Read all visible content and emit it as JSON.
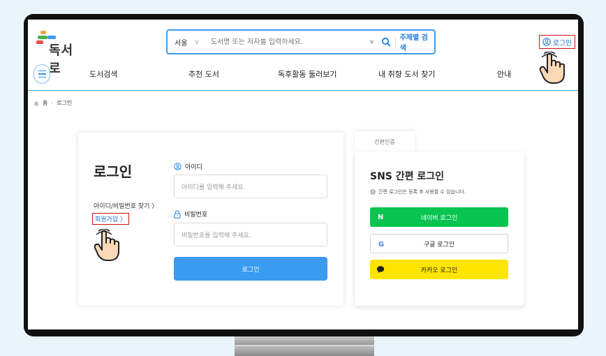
{
  "header": {
    "logo_text": "독서로",
    "search": {
      "region": "서울",
      "placeholder": "도서명 또는 저자를 입력하세요.",
      "topic_search": "주제별 검색"
    },
    "login_link": "로그인"
  },
  "nav": {
    "items": [
      "도서검색",
      "추천 도서",
      "독후활동 둘러보기",
      "내 취향 도서 찾기",
      "안내"
    ]
  },
  "breadcrumb": {
    "home": "홈",
    "current": "로그인"
  },
  "login_panel": {
    "title": "로그인",
    "find_link": "아이디/비밀번호 찾기 〉",
    "join_link": "회원가입 〉",
    "id_label": "아이디",
    "id_placeholder": "아이디를 입력해 주세요.",
    "pw_label": "비밀번호",
    "pw_placeholder": "비밀번호를 입력해 주세요.",
    "login_button": "로그인"
  },
  "sns_panel": {
    "tab": "간편인증",
    "title": "SNS 간편 로그인",
    "note": "간편 로그인은 등록 후 사용할 수 있습니다.",
    "naver": "네이버 로그인",
    "google": "구글 로그인",
    "kakao": "카카오 로그인"
  },
  "colors": {
    "accent": "#3a9bf0",
    "naver": "#08c451",
    "kakao": "#fee500",
    "highlight_box": "#d01010"
  }
}
